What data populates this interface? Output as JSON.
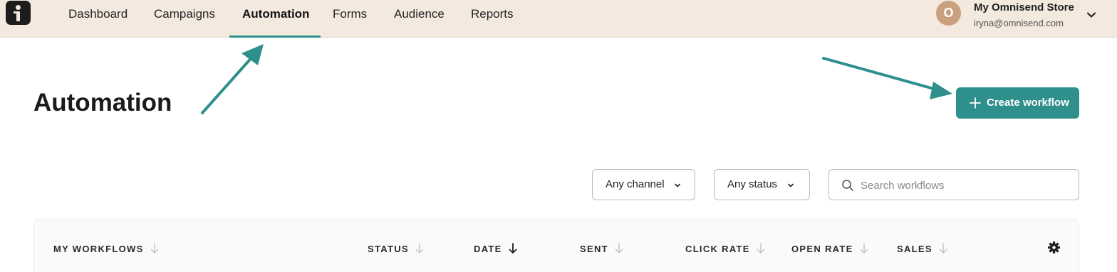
{
  "nav": {
    "items": [
      {
        "label": "Dashboard",
        "active": false
      },
      {
        "label": "Campaigns",
        "active": false
      },
      {
        "label": "Automation",
        "active": true
      },
      {
        "label": "Forms",
        "active": false
      },
      {
        "label": "Audience",
        "active": false
      },
      {
        "label": "Reports",
        "active": false
      }
    ],
    "accent_color": "#2f8f8c"
  },
  "account": {
    "avatar_initial": "O",
    "store_name": "My Omnisend Store",
    "email": "iryna@omnisend.com",
    "avatar_color": "#c9a080"
  },
  "page": {
    "title": "Automation",
    "create_button_label": "Create workflow",
    "create_button_color": "#2f8f8c"
  },
  "filters": {
    "channel": "Any channel",
    "status": "Any status",
    "search_placeholder": "Search workflows"
  },
  "table": {
    "columns": [
      {
        "label": "MY WORKFLOWS",
        "sorted": false
      },
      {
        "label": "STATUS",
        "sorted": false
      },
      {
        "label": "DATE",
        "sorted": true
      },
      {
        "label": "SENT",
        "sorted": false
      },
      {
        "label": "CLICK RATE",
        "sorted": false
      },
      {
        "label": "OPEN RATE",
        "sorted": false
      },
      {
        "label": "SALES",
        "sorted": false
      }
    ]
  },
  "icons": {
    "logo": "omnisend-logo-icon",
    "account_menu": "chevron-down-icon",
    "create": "plus-icon",
    "search": "search-icon",
    "settings": "gear-icon",
    "sort": "arrow-down-icon"
  },
  "annotation_color": "#2f8f8c"
}
